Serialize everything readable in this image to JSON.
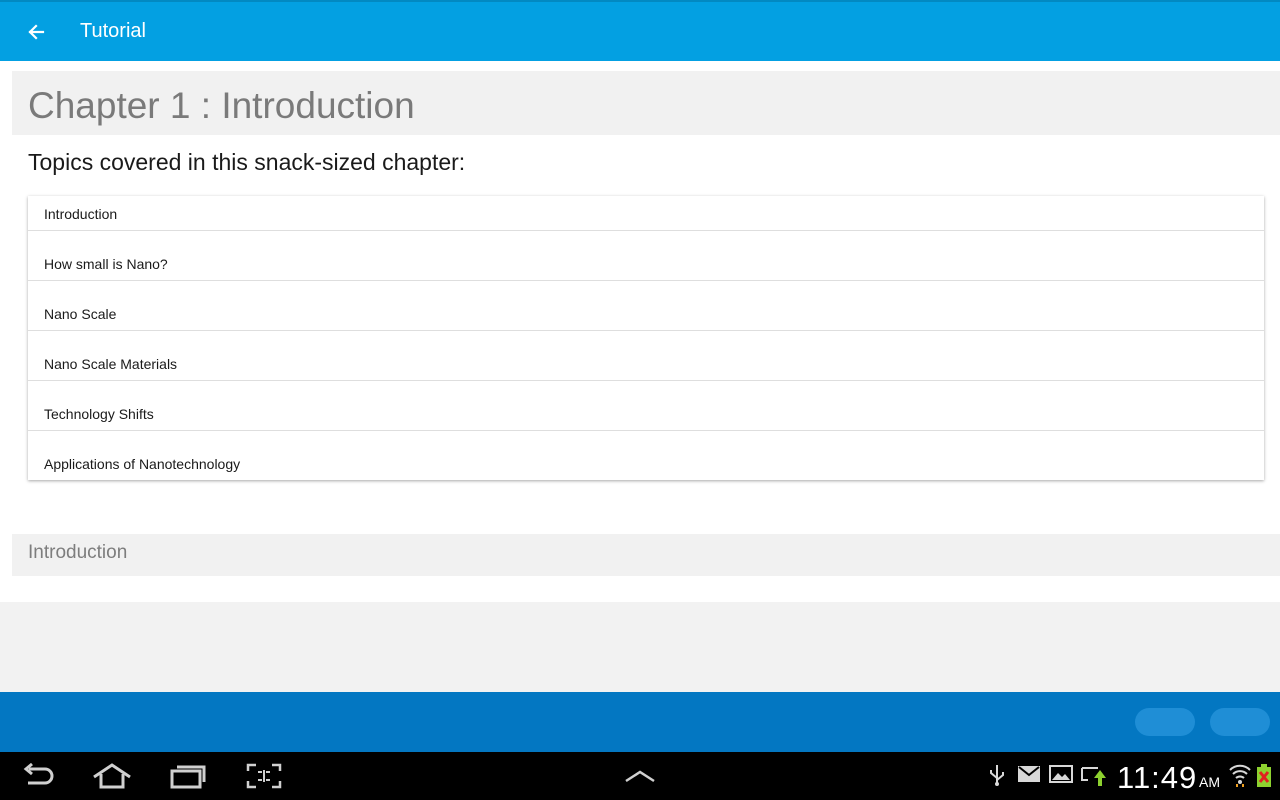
{
  "appbar": {
    "title": "Tutorial",
    "back_icon": "arrow-left-icon"
  },
  "chapter": {
    "title": "Chapter 1 : Introduction"
  },
  "topics": {
    "heading": "Topics covered in this snack-sized chapter:",
    "items": [
      {
        "label": "Introduction"
      },
      {
        "label": "How small is Nano?"
      },
      {
        "label": "Nano Scale"
      },
      {
        "label": "Nano Scale Materials"
      },
      {
        "label": "Technology Shifts"
      },
      {
        "label": "Applications of Nanotechnology"
      }
    ]
  },
  "section": {
    "title": "Introduction"
  },
  "system": {
    "time": "11:49",
    "ampm": "AM",
    "nav_icons": [
      "back-icon",
      "home-icon",
      "recent-apps-icon",
      "screenshot-icon",
      "chevron-up-icon"
    ],
    "status_icons": [
      "usb-icon",
      "mail-icon",
      "gallery-icon",
      "sync-icon",
      "wifi-icon",
      "battery-icon"
    ]
  },
  "colors": {
    "appbar": "#03a0e2",
    "bottombar": "#0377c2",
    "header_bg": "#f1f1f1"
  }
}
